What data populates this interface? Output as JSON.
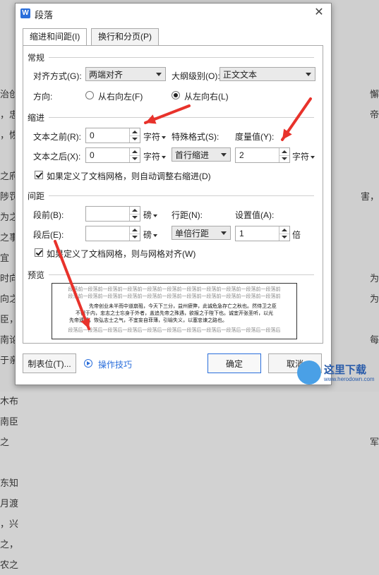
{
  "background_doc": {
    "left_lines": [
      "",
      "治创",
      "，忠",
      "，恢",
      "",
      "之府中",
      "陟罚",
      "为之",
      "之事",
      "宜",
      "时向",
      "向之事",
      "臣，",
      "南论",
      "于亲",
      "",
      "木布",
      "南臣",
      "之",
      "",
      "东知",
      "月渡",
      "，兴",
      "之，",
      "农之"
    ],
    "right_lines": [
      "",
      "懈",
      "帝",
      "",
      "",
      "",
      "害，",
      "",
      "",
      "",
      "为",
      "为",
      "",
      "每",
      "",
      "",
      "",
      "",
      "军",
      "",
      "",
      "",
      "",
      "",
      ""
    ]
  },
  "dialog": {
    "app_icon": "W",
    "title": "段落",
    "close_icon": "close-icon",
    "tabs": [
      "缩进和间距(I)",
      "换行和分页(P)"
    ],
    "general": {
      "section_title": "常规",
      "align_label": "对齐方式(G):",
      "align_value": "两端对齐",
      "outline_label": "大纲级别(O):",
      "outline_value": "正文文本",
      "direction_label": "方向:",
      "rtl_label": "从右向左(F)",
      "ltr_label": "从左向右(L)",
      "direction_selected": "ltr"
    },
    "indent": {
      "section_title": "缩进",
      "before_label": "文本之前(R):",
      "before_value": "0",
      "before_unit": "字符",
      "after_label": "文本之后(X):",
      "after_value": "0",
      "after_unit": "字符",
      "special_label": "特殊格式(S):",
      "special_value": "首行缩进",
      "measure_label": "度量值(Y):",
      "measure_value": "2",
      "measure_unit": "字符",
      "auto_adjust_label": "如果定义了文档网格，则自动调整右缩进(D)",
      "auto_adjust_checked": true
    },
    "spacing": {
      "section_title": "间距",
      "before_label": "段前(B):",
      "before_value": "",
      "before_unit": "磅",
      "after_label": "段后(E):",
      "after_value": "",
      "after_unit": "磅",
      "line_label": "行距(N):",
      "line_value": "单倍行距",
      "setting_label": "设置值(A):",
      "setting_value": "1",
      "setting_unit": "倍",
      "grid_label": "如果定义了文档网格，则与网格对齐(W)",
      "grid_checked": true
    },
    "preview": {
      "section_title": "预览",
      "lines": [
        "段落前一段落前一段落前一段落前一段落前一段落前一段落前一段落前一段落前一段落前一段落前",
        "段落前一段落前一段落前一段落前一段落前一段落前一段落前一段落前一段落前一段落前一段落前",
        "先帝创业未半而中道崩殂，今天下三分，益州疲弊，此诚危急存亡之秋也。然侍卫之臣",
        "不懈于内，忠志之士忘身于外者，盖追先帝之殊遇，欲报之于陛下也。诚宜开张圣听，以光",
        "先帝遗德，恢弘志士之气，不宜妄自菲薄，引喻失义，以塞忠谏之路也。",
        "段落后一段落后一段落后一段落后一段落后一段落后一段落后一段落后一段落后一段落后一段落后"
      ]
    },
    "buttons": {
      "tabstop": "制表位(T)...",
      "tips": "操作技巧",
      "ok": "确定",
      "cancel": "取消"
    }
  },
  "annotation": {
    "arrow_color": "#e8322b"
  },
  "watermark": {
    "text": "这里下载",
    "url": "www.herodown.com"
  }
}
